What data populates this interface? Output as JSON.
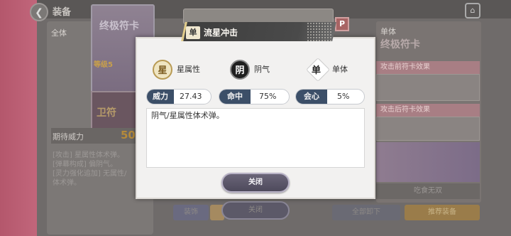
{
  "background": {
    "header_title": "装备",
    "left_tab": "全体",
    "card_rank": "等级5",
    "card_title": "终极符卡",
    "card_sub": "卫符",
    "expect_label": "期待威力",
    "expect_value": "50",
    "description_lines": [
      "[攻击] 星属性体术弹。",
      "[弹幕构成] 偏阴气。",
      "[灵力强化追加] 无属性/",
      "体术弹。"
    ],
    "right_tab": "单体",
    "right_title": "终极符卡",
    "before_effect": "攻击前符卡效果",
    "after_effect": "攻击后符卡效果",
    "right_name": "吃食无双",
    "btn_decorate": "装饰",
    "btn_close": "关闭",
    "btn_unequip_all": "全部卸下",
    "btn_recommend": "推荐装备",
    "p_icon": "P"
  },
  "dialog": {
    "badge": "单",
    "title": "流星冲击",
    "stats": [
      {
        "icon": "星",
        "label": "星属性"
      },
      {
        "icon": "阴",
        "label": "阴气"
      },
      {
        "icon": "单",
        "label": "单体"
      }
    ],
    "pills": [
      {
        "label": "威力",
        "value": "27.43"
      },
      {
        "label": "命中",
        "value": "75%"
      },
      {
        "label": "会心",
        "value": "5%"
      }
    ],
    "description": "阴气/星属性体术弹。",
    "close_label": "关闭"
  }
}
